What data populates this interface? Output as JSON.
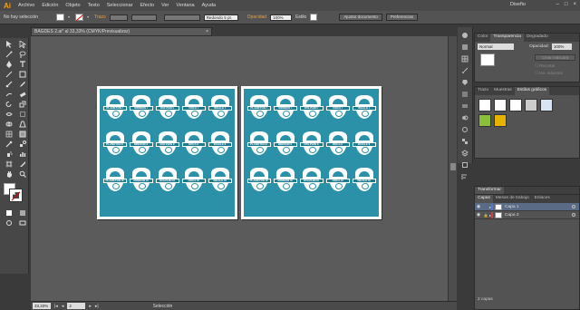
{
  "app": {
    "logo": "Ai",
    "workspace": "Diseño",
    "window_controls": [
      "–",
      "□",
      "×"
    ]
  },
  "menu": [
    "Archivo",
    "Edición",
    "Objeto",
    "Texto",
    "Seleccionar",
    "Efecto",
    "Ver",
    "Ventana",
    "Ayuda"
  ],
  "control_bar": {
    "selection_status": "No hay selección",
    "stroke_label": "Trazo",
    "brush_value": "Redondo 5 pt.",
    "opacity_label": "Opacidad",
    "opacity_value": "100%",
    "style_label": "Estilo",
    "document_setup": "Ajustar documento",
    "preferences": "Preferencias"
  },
  "document": {
    "tab_title": "BAGDES 2.ai* al 33,33% (CMYK/Previsualizar)",
    "close": "×"
  },
  "artboards": [
    {
      "rows": [
        [
          "PLANKTON I",
          "MINNOW I",
          "DOLPHIN I",
          "ORCA I",
          "WHALE I"
        ],
        [
          "PLANKTON II",
          "MINNOW II",
          "DOLPHIN II",
          "ORCA II",
          "WHALE II"
        ],
        [
          "PLANKTON III",
          "MINNOW III",
          "DOLPHIN III",
          "ORCA III",
          "WHALE III"
        ]
      ]
    },
    {
      "rows": [
        [
          "PLANKTON I",
          "MINNOW I",
          "DOLPHIN I",
          "ORCA I",
          "WHALE I"
        ],
        [
          "PLANKTON II",
          "MINNOW II",
          "DOLPHIN II",
          "ORCA II",
          "WHALE II"
        ],
        [
          "PLANKTON III",
          "MINNOW III",
          "DOLPHIN III",
          "ORCA III",
          "WHALE III"
        ]
      ]
    }
  ],
  "free_badge": "WHALE II",
  "status_bar": {
    "zoom": "33,33%",
    "artboard": "2",
    "tool": "Selección"
  },
  "transparency_panel": {
    "tabs": [
      "Color",
      "Transparencia",
      "Degradado"
    ],
    "active_tab": "Transparencia",
    "blend_mode": "Normal",
    "opacity_label": "Opacidad:",
    "opacity_value": "100%",
    "make_mask": "Crear máscara",
    "clip": "Recortar",
    "invert_mask": "Inv. máscara"
  },
  "graphic_styles_panel": {
    "tabs": [
      "Trazo",
      "Muestras",
      "Estilos gráficos"
    ],
    "active_tab": "Estilos gráficos"
  },
  "transform_panel": {
    "title": "Transformar"
  },
  "layers_panel": {
    "tabs": [
      "Capas",
      "Mesas de trabajo",
      "Enlaces"
    ],
    "active_tab": "Capas",
    "layers": [
      {
        "name": "Capa 1",
        "color": "#4b7bd6"
      },
      {
        "name": "Capa 2",
        "color": "#d04040"
      }
    ],
    "count": "2 capas"
  },
  "colors": {
    "teal": "#2b91a8",
    "accent": "#f7a100"
  }
}
